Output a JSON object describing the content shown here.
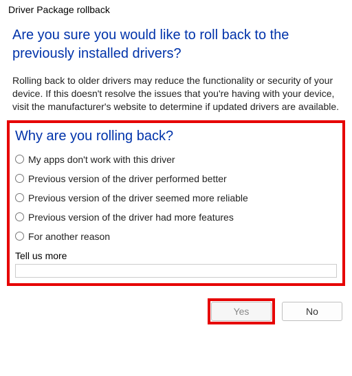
{
  "window": {
    "title": "Driver Package rollback"
  },
  "heading": "Are you sure you would like to roll back to the previously installed drivers?",
  "description": "Rolling back to older drivers may reduce the functionality or security of your device. If this doesn't resolve the issues that you're having with your device, visit the manufacturer's website to determine if updated drivers are available.",
  "survey": {
    "heading": "Why are you rolling back?",
    "options": [
      "My apps don't work with this driver",
      "Previous version of the driver performed better",
      "Previous version of the driver seemed more reliable",
      "Previous version of the driver had more features",
      "For another reason"
    ],
    "tell_us_more_label": "Tell us more",
    "tell_us_more_value": ""
  },
  "buttons": {
    "yes": "Yes",
    "no": "No"
  },
  "highlights": {
    "survey_box": true,
    "yes_button": true
  }
}
